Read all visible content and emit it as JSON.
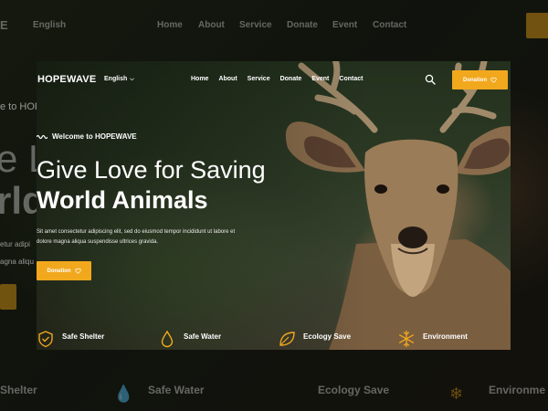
{
  "colors": {
    "accent": "#f2a81d",
    "background": "#1b1e15"
  },
  "background_copy": {
    "logo_fragment": "E",
    "language": "English",
    "nav_items": [
      "Home",
      "About",
      "Service",
      "Donate",
      "Event",
      "Contact"
    ],
    "welcome_fragment": "e to HOP",
    "hero_fragment_1": "e L",
    "hero_fragment_2": "rld",
    "desc_fragment_1": "etur adipi",
    "desc_fragment_2": "agna aliqu",
    "features": [
      "Shelter",
      "Safe Water",
      "Ecology Save",
      "Environme"
    ]
  },
  "header": {
    "logo": "HOPEWAVE",
    "language": "English",
    "nav_items": [
      "Home",
      "About",
      "Service",
      "Donate",
      "Event",
      "Contact"
    ],
    "search_icon": "search-icon",
    "donation_label": "Donation"
  },
  "hero": {
    "welcome": "Welcome to HOPEWAVE",
    "title_line1": "Give Love for Saving",
    "title_line2": "World Animals",
    "description": "Sit amet consectetur adipiscing elit, sed do eiusmod tempor incididunt ut labore et dolore magna aliqua suspendisse ultrices gravida.",
    "donation_label": "Donation"
  },
  "features": [
    {
      "label": "Safe Shelter",
      "icon": "shield-check-icon"
    },
    {
      "label": "Safe Water",
      "icon": "water-drop-icon"
    },
    {
      "label": "Ecology Save",
      "icon": "leaf-icon"
    },
    {
      "label": "Environment",
      "icon": "snowflake-icon"
    }
  ]
}
